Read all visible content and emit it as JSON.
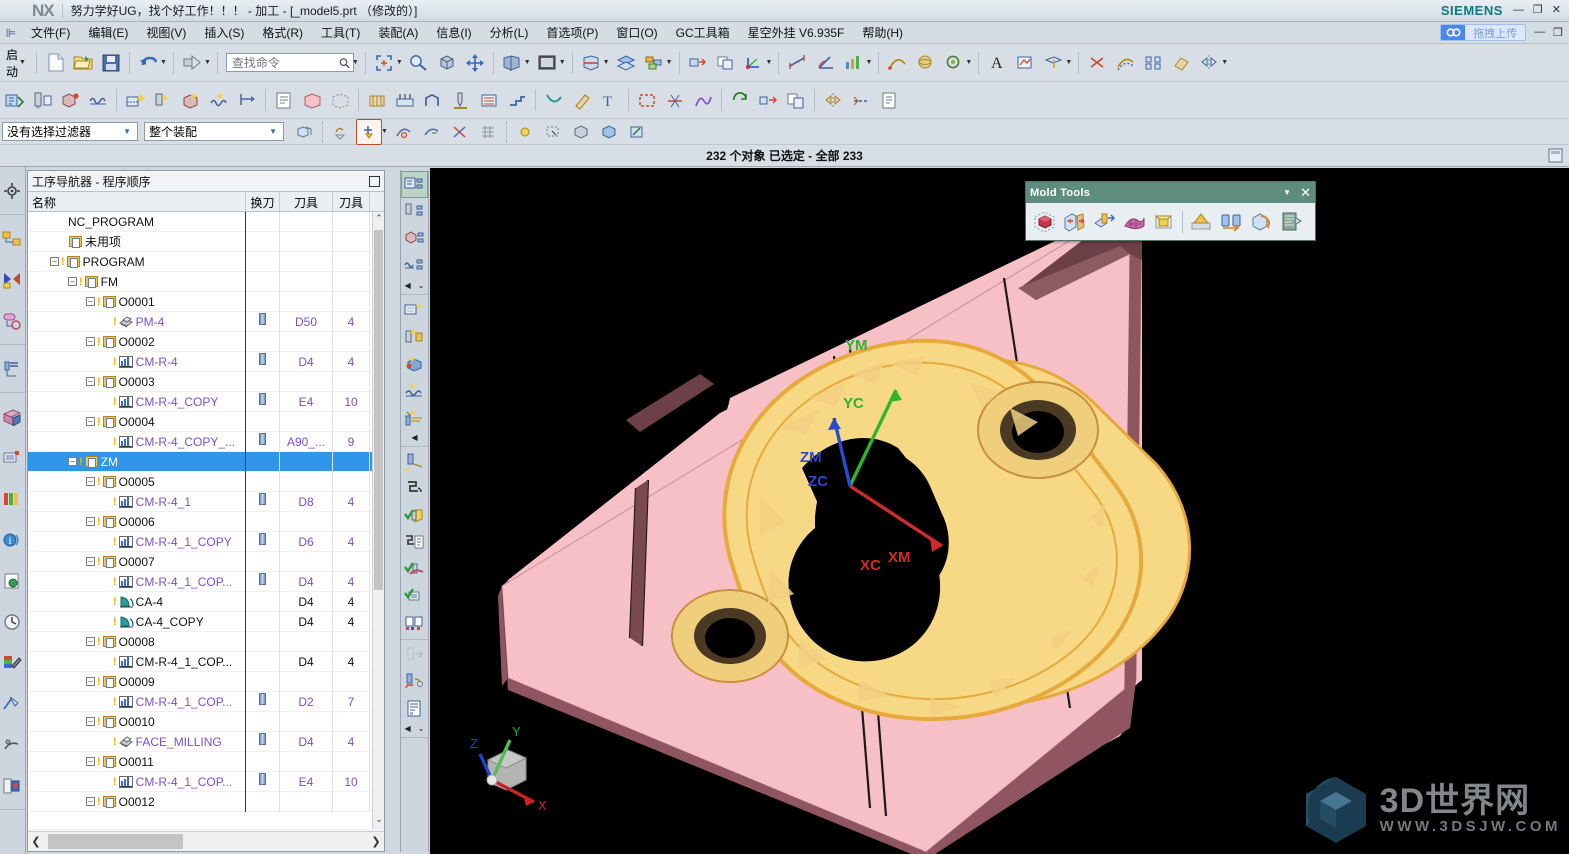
{
  "window": {
    "app_logo": "NX",
    "title": "努力学好UG，找个好工作！！！  - 加工 - [_model5.prt （修改的）]",
    "brand": "SIEMENS",
    "minimize": "—",
    "restore": "❐",
    "close": "✕"
  },
  "menu": {
    "items": [
      {
        "label": "文件(F)"
      },
      {
        "label": "编辑(E)"
      },
      {
        "label": "视图(V)"
      },
      {
        "label": "插入(S)"
      },
      {
        "label": "格式(R)"
      },
      {
        "label": "工具(T)"
      },
      {
        "label": "装配(A)"
      },
      {
        "label": "信息(I)"
      },
      {
        "label": "分析(L)"
      },
      {
        "label": "首选项(P)"
      },
      {
        "label": "窗口(O)"
      },
      {
        "label": "GC工具箱"
      },
      {
        "label": "星空外挂 V6.935F"
      },
      {
        "label": "帮助(H)"
      }
    ],
    "upload_button": {
      "icon": "cloud-upload-icon",
      "label": "拖拽上传"
    },
    "mini_minimize": "—",
    "mini_restore": "❐"
  },
  "toolbar_row1": {
    "start_label": "启动",
    "start_icon": "nx-start-globe-icon",
    "find_placeholder": "查找命令",
    "find_value": "",
    "search_icon": "search-icon",
    "icons": [
      "new-file-icon",
      "open-folder-icon",
      "save-icon",
      "undo-icon",
      "redo-arrow-icon",
      "fit-window-icon",
      "zoom-icon",
      "rotate-cube-icon",
      "pan-icon",
      "perspective-icon",
      "render-style-icon",
      "background-color-icon",
      "section-view-icon",
      "layer-settings-icon",
      "layer-visible-icon",
      "move-object-icon",
      "geometry-copy-icon",
      "wcs-dynamic-icon",
      "measure-distance-icon",
      "measure-angle-icon",
      "analysis-icon",
      "arc-icon",
      "sphere-icon",
      "thread-icon",
      "text-icon",
      "sketch-icon",
      "datum-plane-icon",
      "trim-icon",
      "offset-icon",
      "pattern-icon",
      "extract-icon",
      "mirror-icon"
    ]
  },
  "toolbar_row2": {
    "icons": [
      "create-program-icon",
      "create-tool-icon",
      "create-geometry-icon",
      "create-method-icon",
      "create-operation-icon",
      "generate-toolpath-icon",
      "verify-toolpath-icon",
      "simulate-icon",
      "post-process-icon",
      "shop-doc-icon",
      "workpiece-icon",
      "blank-icon",
      "cavity-mill-icon",
      "face-milling-icon",
      "contour-profile-icon",
      "drill-icon",
      "planar-mill-icon",
      "zlevel-icon",
      "flowcut-icon",
      "engrave-icon",
      "text-milling-icon",
      "boundary-icon",
      "trim-boundary-icon",
      "tool-path-edit-icon",
      "synchronize-icon",
      "transform-icon",
      "copy-paste-icon"
    ]
  },
  "toolbar_row3": {
    "filter_selection": {
      "value": "没有选择过滤器"
    },
    "assembly_scope": {
      "value": "整个装配"
    },
    "icons": [
      "select-assembly-icon",
      "deselect-icon",
      "snap-point-icon",
      "snap-point-dropdown",
      "curve-rule-icon",
      "face-rule-icon",
      "stop-at-intersection-icon",
      "snap-grid-icon",
      "highlight-icon",
      "quick-pick-icon",
      "body-select-icon",
      "feature-select-icon",
      "selection-tool-icon"
    ]
  },
  "status": {
    "cue_text": "232 个对象 已选定 - 全部 233",
    "right_icon": "window-tile-icon"
  },
  "resource_bar": {
    "items": [
      {
        "name": "assembly-navigator-icon"
      },
      {
        "name": "part-navigator-icon"
      },
      {
        "name": "constraint-navigator-icon"
      },
      {
        "name": "reuse-library-icon"
      },
      {
        "name": "operation-navigator-icon"
      },
      {
        "name": "roughing-library-icon"
      },
      {
        "name": "engineering-process-icon"
      },
      {
        "name": "hd3d-tools-icon"
      },
      {
        "name": "web-browser-icon"
      },
      {
        "name": "history-icon"
      },
      {
        "name": "palette-icon"
      },
      {
        "name": "manufacturing-wizard-icon"
      },
      {
        "name": "role-advanced-icon"
      },
      {
        "name": "system-scene-icon"
      }
    ]
  },
  "navigator": {
    "title": "工序导航器 - 程序顺序",
    "pin_icon": "dock-pin-icon",
    "columns": [
      "名称",
      "换刀",
      "刀具",
      "刀具号"
    ],
    "scroll": {
      "up": "⌃",
      "down": "⌄",
      "left": "❮",
      "right": "❯"
    },
    "rows": [
      {
        "indent": 0,
        "expander": "",
        "warn": false,
        "icon": "none",
        "label": "NC_PROGRAM",
        "color": "black",
        "tc": false,
        "tool": "",
        "num": "",
        "selected": false
      },
      {
        "indent": 1,
        "expander": "",
        "warn": false,
        "icon": "folder",
        "label": "未用项",
        "color": "black",
        "tc": false,
        "tool": "",
        "num": "",
        "selected": false
      },
      {
        "indent": 1,
        "expander": "–",
        "warn": true,
        "icon": "folder",
        "label": "PROGRAM",
        "color": "black",
        "tc": false,
        "tool": "",
        "num": "",
        "selected": false
      },
      {
        "indent": 2,
        "expander": "–",
        "warn": true,
        "icon": "folder",
        "label": "FM",
        "color": "black",
        "tc": false,
        "tool": "",
        "num": "",
        "selected": false
      },
      {
        "indent": 3,
        "expander": "–",
        "warn": true,
        "icon": "folder",
        "label": "O0001",
        "color": "black",
        "tc": false,
        "tool": "",
        "num": "",
        "selected": false
      },
      {
        "indent": 4,
        "expander": "",
        "warn": true,
        "icon": "face",
        "label": "PM-4",
        "color": "purple",
        "tc": true,
        "tool": "D50",
        "num": "4",
        "selected": false
      },
      {
        "indent": 3,
        "expander": "–",
        "warn": true,
        "icon": "folder",
        "label": "O0002",
        "color": "black",
        "tc": false,
        "tool": "",
        "num": "",
        "selected": false
      },
      {
        "indent": 4,
        "expander": "",
        "warn": true,
        "icon": "mill",
        "label": "CM-R-4",
        "color": "purple",
        "tc": true,
        "tool": "D4",
        "num": "4",
        "selected": false
      },
      {
        "indent": 3,
        "expander": "–",
        "warn": true,
        "icon": "folder",
        "label": "O0003",
        "color": "black",
        "tc": false,
        "tool": "",
        "num": "",
        "selected": false
      },
      {
        "indent": 4,
        "expander": "",
        "warn": true,
        "icon": "mill",
        "label": "CM-R-4_COPY",
        "color": "purple",
        "tc": true,
        "tool": "E4",
        "num": "10",
        "selected": false
      },
      {
        "indent": 3,
        "expander": "–",
        "warn": true,
        "icon": "folder",
        "label": "O0004",
        "color": "black",
        "tc": false,
        "tool": "",
        "num": "",
        "selected": false
      },
      {
        "indent": 4,
        "expander": "",
        "warn": true,
        "icon": "mill",
        "label": "CM-R-4_COPY_...",
        "color": "purple",
        "tc": true,
        "tool": "A90_...",
        "num": "9",
        "selected": false
      },
      {
        "indent": 2,
        "expander": "–",
        "warn": true,
        "icon": "folder",
        "label": "ZM",
        "color": "black",
        "tc": false,
        "tool": "",
        "num": "",
        "selected": true
      },
      {
        "indent": 3,
        "expander": "–",
        "warn": true,
        "icon": "folder",
        "label": "O0005",
        "color": "black",
        "tc": false,
        "tool": "",
        "num": "",
        "selected": false
      },
      {
        "indent": 4,
        "expander": "",
        "warn": true,
        "icon": "mill",
        "label": "CM-R-4_1",
        "color": "purple",
        "tc": true,
        "tool": "D8",
        "num": "4",
        "selected": false
      },
      {
        "indent": 3,
        "expander": "–",
        "warn": true,
        "icon": "folder",
        "label": "O0006",
        "color": "black",
        "tc": false,
        "tool": "",
        "num": "",
        "selected": false
      },
      {
        "indent": 4,
        "expander": "",
        "warn": true,
        "icon": "mill",
        "label": "CM-R-4_1_COPY",
        "color": "purple",
        "tc": true,
        "tool": "D6",
        "num": "4",
        "selected": false
      },
      {
        "indent": 3,
        "expander": "–",
        "warn": true,
        "icon": "folder",
        "label": "O0007",
        "color": "black",
        "tc": false,
        "tool": "",
        "num": "",
        "selected": false
      },
      {
        "indent": 4,
        "expander": "",
        "warn": true,
        "icon": "mill",
        "label": "CM-R-4_1_COP...",
        "color": "purple",
        "tc": true,
        "tool": "D4",
        "num": "4",
        "selected": false
      },
      {
        "indent": 4,
        "expander": "",
        "warn": true,
        "icon": "flowcut",
        "label": "CA-4",
        "color": "black",
        "tc": false,
        "tool": "D4",
        "num": "4",
        "selected": false
      },
      {
        "indent": 4,
        "expander": "",
        "warn": true,
        "icon": "flowcut",
        "label": "CA-4_COPY",
        "color": "black",
        "tc": false,
        "tool": "D4",
        "num": "4",
        "selected": false
      },
      {
        "indent": 3,
        "expander": "–",
        "warn": true,
        "icon": "folder",
        "label": "O0008",
        "color": "black",
        "tc": false,
        "tool": "",
        "num": "",
        "selected": false
      },
      {
        "indent": 4,
        "expander": "",
        "warn": true,
        "icon": "mill",
        "label": "CM-R-4_1_COP...",
        "color": "black",
        "tc": false,
        "tool": "D4",
        "num": "4",
        "selected": false
      },
      {
        "indent": 3,
        "expander": "–",
        "warn": true,
        "icon": "folder",
        "label": "O0009",
        "color": "black",
        "tc": false,
        "tool": "",
        "num": "",
        "selected": false
      },
      {
        "indent": 4,
        "expander": "",
        "warn": true,
        "icon": "mill",
        "label": "CM-R-4_1_COP...",
        "color": "purple",
        "tc": true,
        "tool": "D2",
        "num": "7",
        "selected": false
      },
      {
        "indent": 3,
        "expander": "–",
        "warn": true,
        "icon": "folder",
        "label": "O0010",
        "color": "black",
        "tc": false,
        "tool": "",
        "num": "",
        "selected": false
      },
      {
        "indent": 4,
        "expander": "",
        "warn": true,
        "icon": "face",
        "label": "FACE_MILLING",
        "color": "purple",
        "tc": true,
        "tool": "D4",
        "num": "4",
        "selected": false
      },
      {
        "indent": 3,
        "expander": "–",
        "warn": true,
        "icon": "folder",
        "label": "O0011",
        "color": "black",
        "tc": false,
        "tool": "",
        "num": "",
        "selected": false
      },
      {
        "indent": 4,
        "expander": "",
        "warn": true,
        "icon": "mill",
        "label": "CM-R-4_1_COP...",
        "color": "purple",
        "tc": true,
        "tool": "E4",
        "num": "10",
        "selected": false
      },
      {
        "indent": 3,
        "expander": "–",
        "warn": true,
        "icon": "folder",
        "label": "O0012",
        "color": "black",
        "tc": false,
        "tool": "",
        "num": "",
        "selected": false
      }
    ]
  },
  "operation_toolbar": {
    "groups": [
      {
        "items": [
          "program-order-view-icon",
          "machine-tool-view-icon",
          "geometry-view-icon",
          "machining-method-view-icon"
        ],
        "chevrons": [
          "◀",
          "⌄"
        ]
      },
      {
        "items": [
          "create-program-icon",
          "create-tool-icon",
          "create-geometry-icon",
          "create-method-icon",
          "create-operation-icon"
        ],
        "chevrons": [
          "◀"
        ]
      },
      {
        "items": [
          "generate-icon",
          "replay-icon",
          "verify-icon",
          "list-icon",
          "confirm-icon",
          "machine-simulate-icon",
          "compare-icon"
        ],
        "chevrons": []
      },
      {
        "items": [
          "transfer-icon",
          "post-process-icon",
          "shop-documentation-icon"
        ],
        "chevrons": [
          "◀",
          "⌄"
        ]
      }
    ]
  },
  "mold_tools": {
    "title": "Mold Tools",
    "dropdown_icon": "toolbar-options-icon",
    "close_icon": "close-icon",
    "buttons": [
      {
        "name": "create-box-icon"
      },
      {
        "name": "split-solid-icon"
      },
      {
        "name": "extract-region-icon"
      },
      {
        "name": "patch-surface-icon"
      },
      {
        "name": "enlarge-surface-icon"
      },
      {
        "name": "trim-region-icon"
      },
      {
        "name": "replace-solid-icon"
      },
      {
        "name": "reverse-solid-icon"
      },
      {
        "name": "mold-wizard-icon"
      }
    ]
  },
  "viewport": {
    "csys_labels": [
      {
        "text": "YM",
        "color": "#2db52d"
      },
      {
        "text": "YC",
        "color": "#2db52d"
      },
      {
        "text": "ZM",
        "color": "#2a4bd0"
      },
      {
        "text": "ZC",
        "color": "#2a4bd0"
      },
      {
        "text": "XC",
        "color": "#d02a2a"
      },
      {
        "text": "XM",
        "color": "#d02a2a"
      }
    ],
    "axis_triad": [
      {
        "text": "X",
        "color": "#cc2222"
      },
      {
        "text": "Y",
        "color": "#22aa22"
      },
      {
        "text": "Z",
        "color": "#2244cc"
      }
    ],
    "colors": {
      "background": "#000000",
      "plate_pink": "#f7c0c7",
      "plate_side": "#8f5560",
      "pocket_yellow": "#f7d884",
      "pocket_edge": "#e8a93c",
      "core_black": "#000000"
    },
    "watermark": {
      "main": "3D世界网",
      "sub": "WWW.3DSJW.COM",
      "logo": "hexagon-cube-logo"
    }
  }
}
